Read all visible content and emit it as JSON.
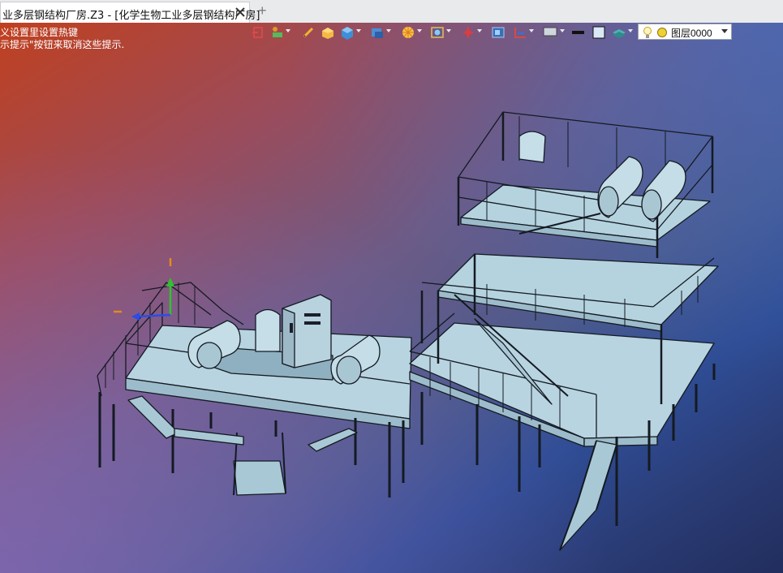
{
  "tab": {
    "title": "业多层钢结构厂房.Z3 - [化学生物工业多层钢结构厂房]",
    "close_icon": "close-icon",
    "new_tab_icon": "plus-icon",
    "new_tab_label": "+"
  },
  "viewport": {
    "hint_line_1": "义设置里设置热键",
    "hint_line_2": "示提示\"按钮来取消这些提示."
  },
  "toolbar": {
    "icons": [
      "exit-sketch-icon",
      "flag-filter-icon",
      "pencil-icon",
      "box-render-icon",
      "cube-view-icon",
      "display-mode-icon",
      "color-wheel-icon",
      "zoom-fit-icon",
      "axis-icon",
      "rectangle-select-icon",
      "axis-align-icon",
      "monitor-icon",
      "line-style-icon",
      "fill-color-icon",
      "layer-stack-icon"
    ],
    "layer": {
      "label": "图层0000",
      "icons": [
        "lightbulb-icon",
        "status-circle-icon",
        "dropdown-arrow-icon"
      ]
    }
  },
  "colors": {
    "model_fill": "#b5d3df",
    "model_edge": "#141a22",
    "triad_x": "#2a4de8",
    "triad_y": "#2fc22f",
    "triad_z": "#e38a1f"
  }
}
